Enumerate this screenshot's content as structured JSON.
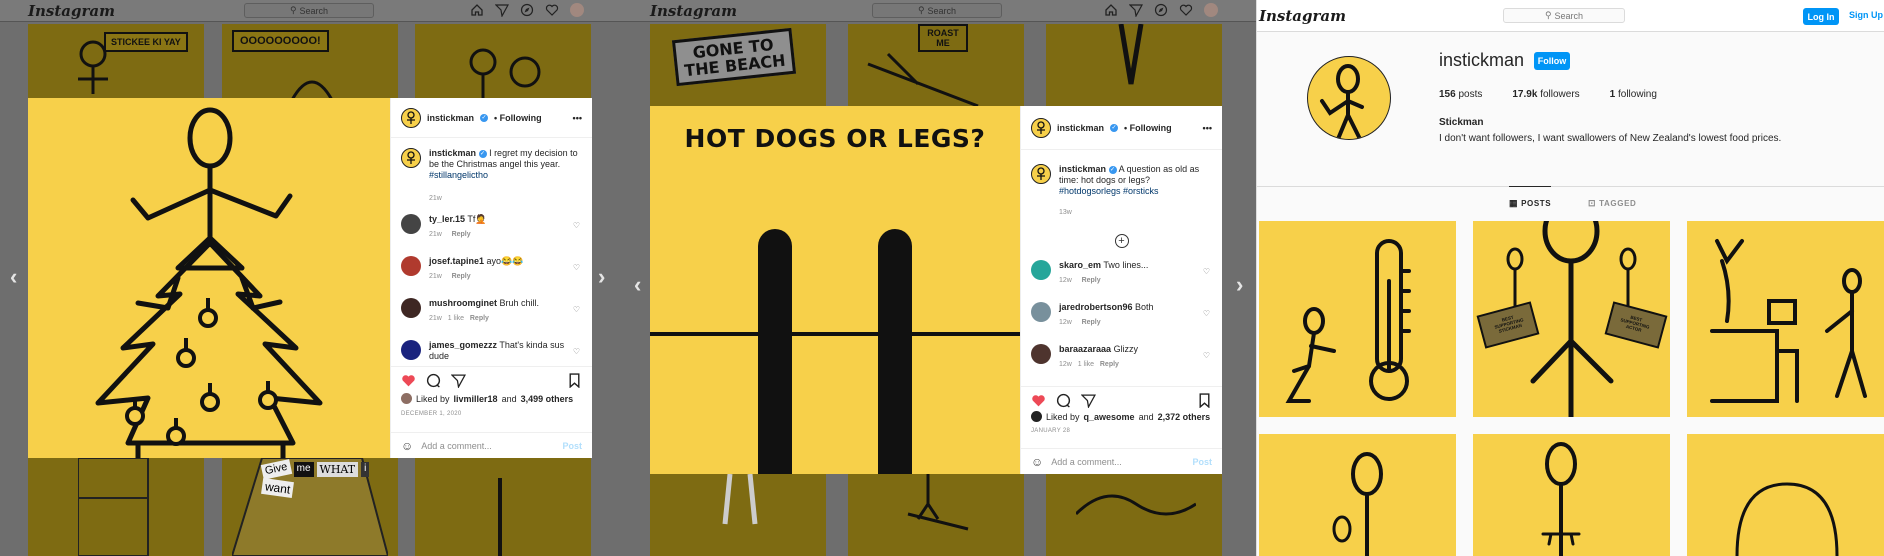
{
  "panel1": {
    "brand": "Instagram",
    "search_placeholder": "Search",
    "tiles_text": [
      "STICKEE KI YAY",
      "OOOOOOOOO!"
    ],
    "ransom_words": [
      "Give",
      "me",
      "WHAT",
      "i",
      "want"
    ],
    "post": {
      "username": "instickman",
      "following": "• Following",
      "caption": "I regret my decision to be the Christmas angel this year.",
      "hashtag": "#stillangelictho",
      "caption_time": "21w",
      "comments": [
        {
          "user": "ty_ler.15",
          "text": "Tf🤦",
          "time": "21w",
          "likes": "",
          "reply": "Reply",
          "color": "#444"
        },
        {
          "user": "josef.tapine1",
          "text": "ayo😂😂",
          "time": "21w",
          "likes": "",
          "reply": "Reply",
          "color": "#b03a2e"
        },
        {
          "user": "mushroomginet",
          "text": "Bruh chill.",
          "time": "21w",
          "likes": "1 like",
          "reply": "Reply",
          "color": "#3e2723"
        },
        {
          "user": "james_gomezzz",
          "text": "That's kinda sus dude",
          "time": "",
          "likes": "",
          "reply": "",
          "color": "#1a237e"
        }
      ],
      "liked_prefix": "Liked by",
      "liked_user": "livmiller18",
      "liked_suffix": "and",
      "liked_others": "3,499 others",
      "date": "DECEMBER 1, 2020",
      "add_comment": "Add a comment...",
      "post_btn": "Post"
    }
  },
  "panel2": {
    "brand": "Instagram",
    "search_placeholder": "Search",
    "tiles_text": [
      "GONE TO THE BEACH",
      "ROAST ME"
    ],
    "post": {
      "image_title": "HOT DOGS OR LEGS?",
      "username": "instickman",
      "following": "• Following",
      "caption": "A question as old as time: hot dogs or legs?",
      "hashtag": "#hotdogsorlegs #orsticks",
      "caption_time": "13w",
      "comments": [
        {
          "user": "skaro_em",
          "text": "Two lines...",
          "time": "12w",
          "likes": "",
          "reply": "Reply",
          "color": "#26a69a"
        },
        {
          "user": "jaredrobertson96",
          "text": "Both",
          "time": "12w",
          "likes": "",
          "reply": "Reply",
          "color": "#78909c"
        },
        {
          "user": "baraazaraaa",
          "text": "Glizzy",
          "time": "12w",
          "likes": "1 like",
          "reply": "Reply",
          "color": "#4e342e"
        }
      ],
      "liked_prefix": "Liked by",
      "liked_user": "q_awesome",
      "liked_suffix": "and",
      "liked_others": "2,372 others",
      "date": "JANUARY 28",
      "add_comment": "Add a comment...",
      "post_btn": "Post"
    }
  },
  "panel3": {
    "brand": "Instagram",
    "search_placeholder": "Search",
    "login": "Log In",
    "signup": "Sign Up",
    "username": "instickman",
    "follow": "Follow",
    "posts_count": "156",
    "posts_label": "posts",
    "followers_count": "17.9k",
    "followers_label": "followers",
    "following_count": "1",
    "following_label": "following",
    "name": "Stickman",
    "bio": "I don't want followers, I want swallowers of New Zealand's lowest food prices.",
    "tab_posts": "POSTS",
    "tab_tagged": "TAGGED",
    "sign_texts": [
      "BEST SUPPORTING STICKMAN",
      "BEST SUPPORTING ACTOR"
    ]
  },
  "colors": {
    "brand_yellow": "#f7d04a",
    "like_red": "#ed4956",
    "blue": "#0095f6"
  }
}
